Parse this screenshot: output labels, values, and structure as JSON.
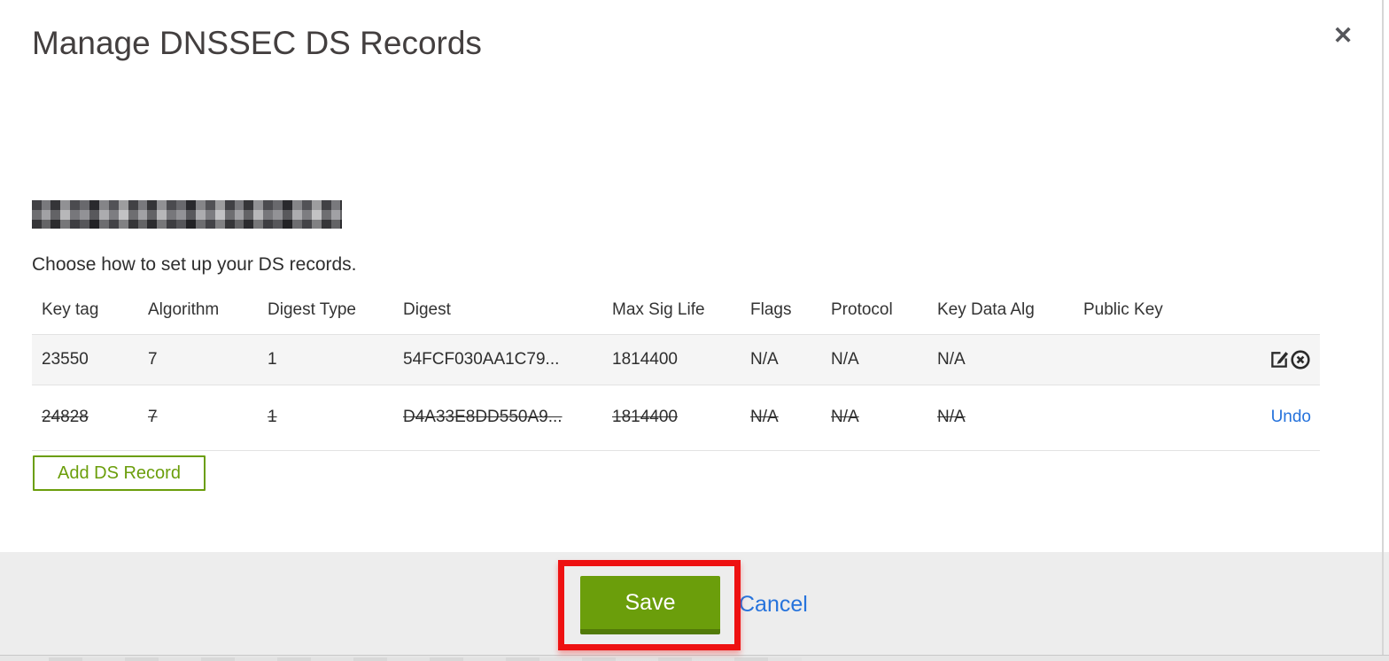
{
  "dialog": {
    "title": "Manage DNSSEC DS Records",
    "close_glyph": "✕",
    "instruction": "Choose how to set up your DS records."
  },
  "table": {
    "columns": [
      "Key tag",
      "Algorithm",
      "Digest Type",
      "Digest",
      "Max Sig Life",
      "Flags",
      "Protocol",
      "Key Data Alg",
      "Public Key"
    ],
    "rows": [
      {
        "key_tag": "23550",
        "algorithm": "7",
        "digest_type": "1",
        "digest": "54FCF030AA1C79...",
        "max_sig_life": "1814400",
        "flags": "N/A",
        "protocol": "N/A",
        "key_data_alg": "N/A",
        "public_key": "",
        "status": "active"
      },
      {
        "key_tag": "24828",
        "algorithm": "7",
        "digest_type": "1",
        "digest": "D4A33E8DD550A9...",
        "max_sig_life": "1814400",
        "flags": "N/A",
        "protocol": "N/A",
        "key_data_alg": "N/A",
        "public_key": "",
        "status": "marked-for-deletion",
        "action_label": "Undo"
      }
    ]
  },
  "buttons": {
    "add_ds_record": "Add DS Record",
    "save": "Save",
    "cancel": "Cancel"
  },
  "icons": {
    "close": "close-icon",
    "edit": "edit-icon",
    "delete": "circle-x-icon"
  },
  "colors": {
    "green": "#6b9e0b",
    "green_dark": "#527a08",
    "link_blue": "#2673dc",
    "annotation_red": "#ee1111",
    "footer_bg": "#ededed",
    "active_row_bg": "#f5f5f5"
  }
}
